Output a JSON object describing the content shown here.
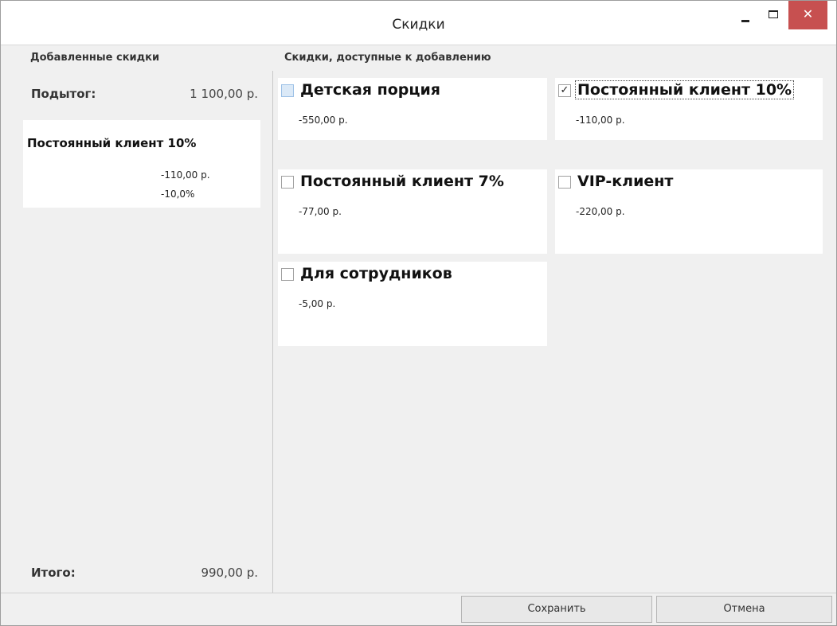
{
  "window": {
    "title": "Скидки",
    "minimize_glyph": "",
    "maximize_glyph": "",
    "close_glyph": "✕"
  },
  "left": {
    "header": "Добавленные скидки",
    "subtotal_label": "Подытог:",
    "subtotal_value": "1 100,00 р.",
    "applied": [
      {
        "name": "Постоянный клиент 10%",
        "amount": "-110,00 р.",
        "percent": "-10,0%"
      }
    ],
    "total_label": "Итого:",
    "total_value": "990,00 р."
  },
  "right": {
    "header": "Скидки, доступные к добавлению",
    "discounts": [
      {
        "name": "Детская порция",
        "amount": "-550,00 р.",
        "checked": false,
        "check_glyph": ""
      },
      {
        "name": "Постоянный клиент 10%",
        "amount": "-110,00 р.",
        "checked": true,
        "check_glyph": "✓"
      },
      {
        "name": "Постоянный клиент 7%",
        "amount": "-77,00 р.",
        "checked": false,
        "check_glyph": ""
      },
      {
        "name": "VIP-клиент",
        "amount": "-220,00 р.",
        "checked": false,
        "check_glyph": ""
      },
      {
        "name": "Для сотрудников",
        "amount": "-5,00 р.",
        "checked": false,
        "check_glyph": ""
      }
    ]
  },
  "footer": {
    "save_label": "Сохранить",
    "cancel_label": "Отмена"
  },
  "colors": {
    "close_button": "#c75050",
    "background": "#f0f0f0",
    "card": "#ffffff"
  }
}
